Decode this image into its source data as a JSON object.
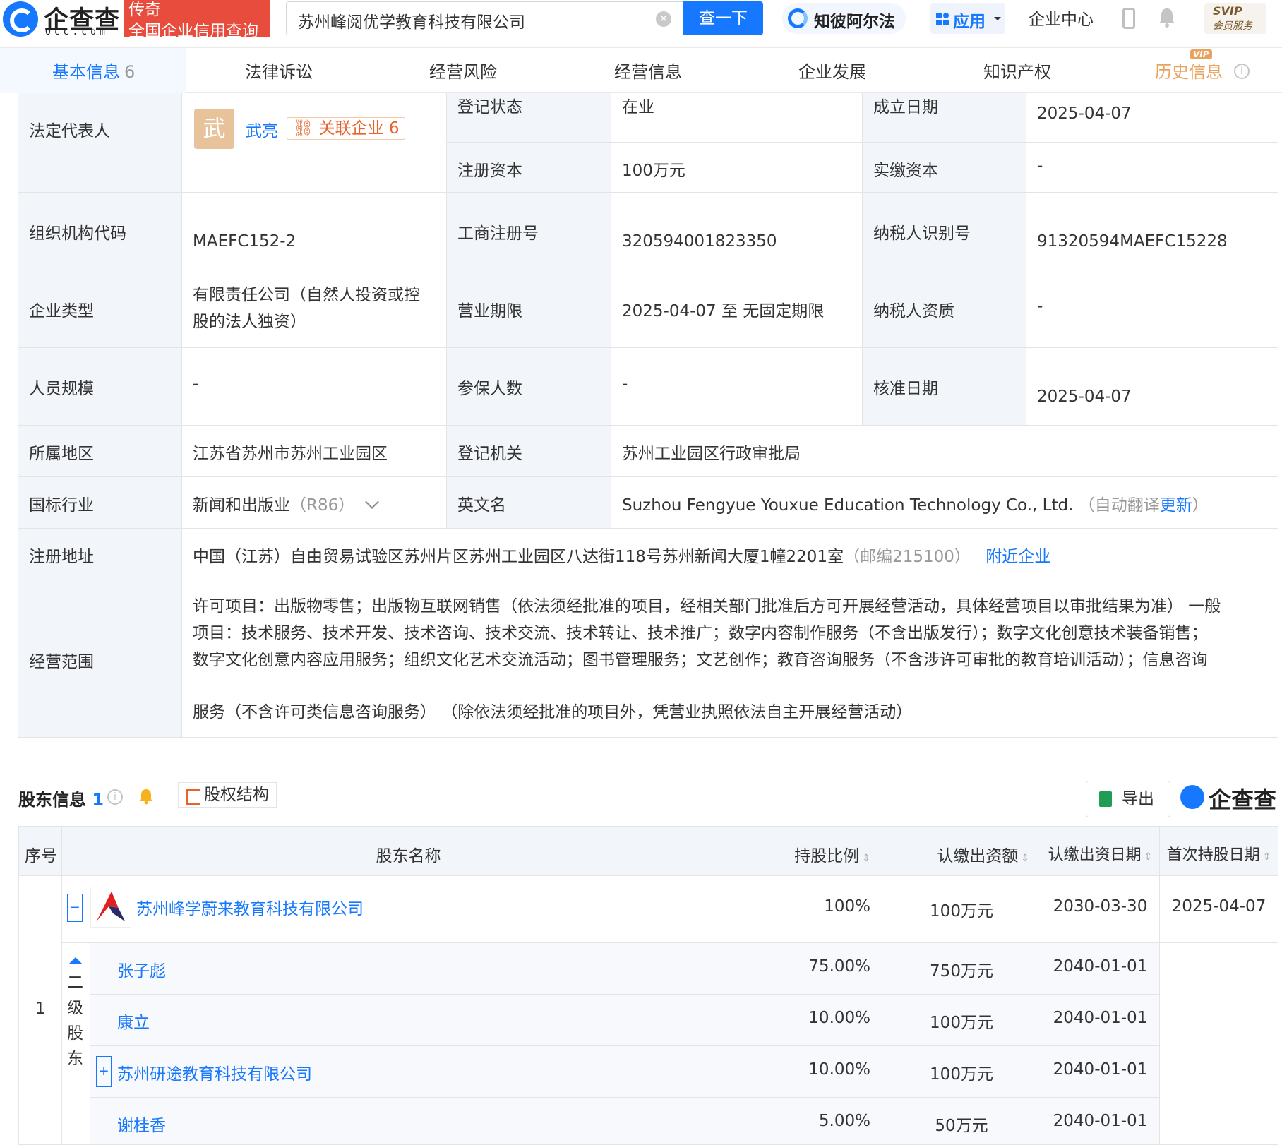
{
  "header": {
    "logo_text": "企查查",
    "logo_sub": "Qcc.com",
    "slogan_line1": "传奇",
    "slogan_line2": "全国企业信用查询",
    "search_value": "苏州峰阅优学教育科技有限公司",
    "search_button": "查一下",
    "ai_label": "知彼阿尔法",
    "app_label": "应用",
    "enterprise_center": "企业中心",
    "svip_line1": "SVIP",
    "svip_line2": "会员服务"
  },
  "tabs": [
    {
      "label": "基本信息",
      "count": "6"
    },
    {
      "label": "法律诉讼"
    },
    {
      "label": "经营风险"
    },
    {
      "label": "经营信息"
    },
    {
      "label": "企业发展"
    },
    {
      "label": "知识产权"
    },
    {
      "label": "历史信息",
      "tag": "VIP"
    }
  ],
  "info": {
    "legal_rep_label": "法定代表人",
    "legal_rep_avatar": "武",
    "legal_rep_name": "武亮",
    "related_label": "关联企业",
    "related_count": "6",
    "reg_status_label": "登记状态",
    "reg_status": "在业",
    "est_date_label": "成立日期",
    "est_date": "2025-04-07",
    "reg_capital_label": "注册资本",
    "reg_capital": "100万元",
    "paid_capital_label": "实缴资本",
    "paid_capital": "-",
    "org_code_label": "组织机构代码",
    "org_code": "MAEFC152-2",
    "biz_reg_no_label": "工商注册号",
    "biz_reg_no": "320594001823350",
    "taxpayer_id_label": "纳税人识别号",
    "taxpayer_id": "91320594MAEFC15228",
    "ent_type_label": "企业类型",
    "ent_type_line1": "有限责任公司（自然人投资或控",
    "ent_type_line2": "股的法人独资）",
    "biz_term_label": "营业期限",
    "biz_term": "2025-04-07 至 无固定期限",
    "taxpayer_qual_label": "纳税人资质",
    "taxpayer_qual": "-",
    "staff_size_label": "人员规模",
    "staff_size": "-",
    "insured_label": "参保人数",
    "insured": "-",
    "approve_date_label": "核准日期",
    "approve_date": "2025-04-07",
    "region_label": "所属地区",
    "region": "江苏省苏州市苏州工业园区",
    "reg_authority_label": "登记机关",
    "reg_authority": "苏州工业园区行政审批局",
    "industry_label": "国标行业",
    "industry": "新闻和出版业",
    "industry_code": "（R86）",
    "en_name_label": "英文名",
    "en_name": "Suzhou Fengyue Youxue Education Technology Co., Ltd.",
    "en_name_note_pre": "（自动翻译",
    "en_name_update": "更新",
    "en_name_note_post": "）",
    "address_label": "注册地址",
    "address": "中国（江苏）自由贸易试验区苏州片区苏州工业园区八达街118号苏州新闻大厦1幢2201室",
    "postcode": "（邮编215100）",
    "nearby": "附近企业",
    "scope_label": "经营范围",
    "scope_line1": "许可项目：出版物零售；出版物互联网销售（依法须经批准的项目，经相关部门批准后方可开展经营活动，具体经营项目以审批结果为准） 一般",
    "scope_line2": "项目：技术服务、技术开发、技术咨询、技术交流、技术转让、技术推广；数字内容制作服务（不含出版发行）；数字文化创意技术装备销售；",
    "scope_line3": "数字文化创意内容应用服务；组织文化艺术交流活动；图书管理服务；文艺创作；教育咨询服务（不含涉许可审批的教育培训活动）；信息咨询",
    "scope_line4": "服务（不含许可类信息咨询服务） （除依法须经批准的项目外，凭营业执照依法自主开展经营活动）"
  },
  "shareholders": {
    "title": "股东信息",
    "count": "1",
    "structure_btn": "股权结构",
    "export_btn": "导出",
    "logo": "企查查",
    "columns": [
      "序号",
      "股东名称",
      "持股比例",
      "认缴出资额",
      "认缴出资日期",
      "首次持股日期"
    ],
    "index": "1",
    "level2_label": [
      "二",
      "级",
      "股",
      "东"
    ],
    "main": {
      "name": "苏州峰学蔚来教育科技有限公司",
      "ratio": "100%",
      "amount": "100万元",
      "sub_date": "2030-03-30",
      "first_date": "2025-04-07"
    },
    "subs": [
      {
        "name": "张子彪",
        "ratio": "75.00%",
        "amount": "750万元",
        "sub_date": "2040-01-01"
      },
      {
        "name": "康立",
        "ratio": "10.00%",
        "amount": "100万元",
        "sub_date": "2040-01-01"
      },
      {
        "name": "苏州研途教育科技有限公司",
        "ratio": "10.00%",
        "amount": "100万元",
        "sub_date": "2040-01-01"
      },
      {
        "name": "谢桂香",
        "ratio": "5.00%",
        "amount": "50万元",
        "sub_date": "2040-01-01"
      }
    ]
  },
  "colors": {
    "accent": "#1677ff",
    "label_bg": "#f2f5fa",
    "slogan": "#e84c3d",
    "vip": "#e8a45f"
  }
}
